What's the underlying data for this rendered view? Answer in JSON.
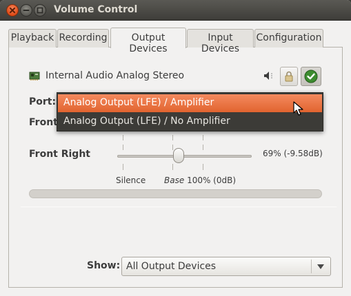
{
  "window": {
    "title": "Volume Control"
  },
  "tabs": [
    {
      "label": "Playback"
    },
    {
      "label": "Recording"
    },
    {
      "label": "Output Devices",
      "active": true
    },
    {
      "label": "Input Devices"
    },
    {
      "label": "Configuration"
    }
  ],
  "device": {
    "name": "Internal Audio Analog Stereo",
    "icon": "sound-card-icon",
    "port_label": "Port:",
    "port_options": [
      {
        "label": "Analog Output (LFE) / Amplifier",
        "selected": true
      },
      {
        "label": "Analog Output (LFE) / No Amplifier"
      }
    ],
    "channels": [
      {
        "label": "Front"
      },
      {
        "label": "Front Right",
        "volume_percent": 69,
        "volume_text": "69% (-9.58dB)"
      }
    ],
    "slider_labels": {
      "silence": "Silence",
      "base_word": "Base",
      "base_value": "100% (0dB)"
    }
  },
  "footer": {
    "show_label": "Show:",
    "show_value": "All Output Devices"
  },
  "colors": {
    "accent": "#e1642f",
    "titlebar": "#3c3b37",
    "window_bg": "#f2f1f0"
  }
}
